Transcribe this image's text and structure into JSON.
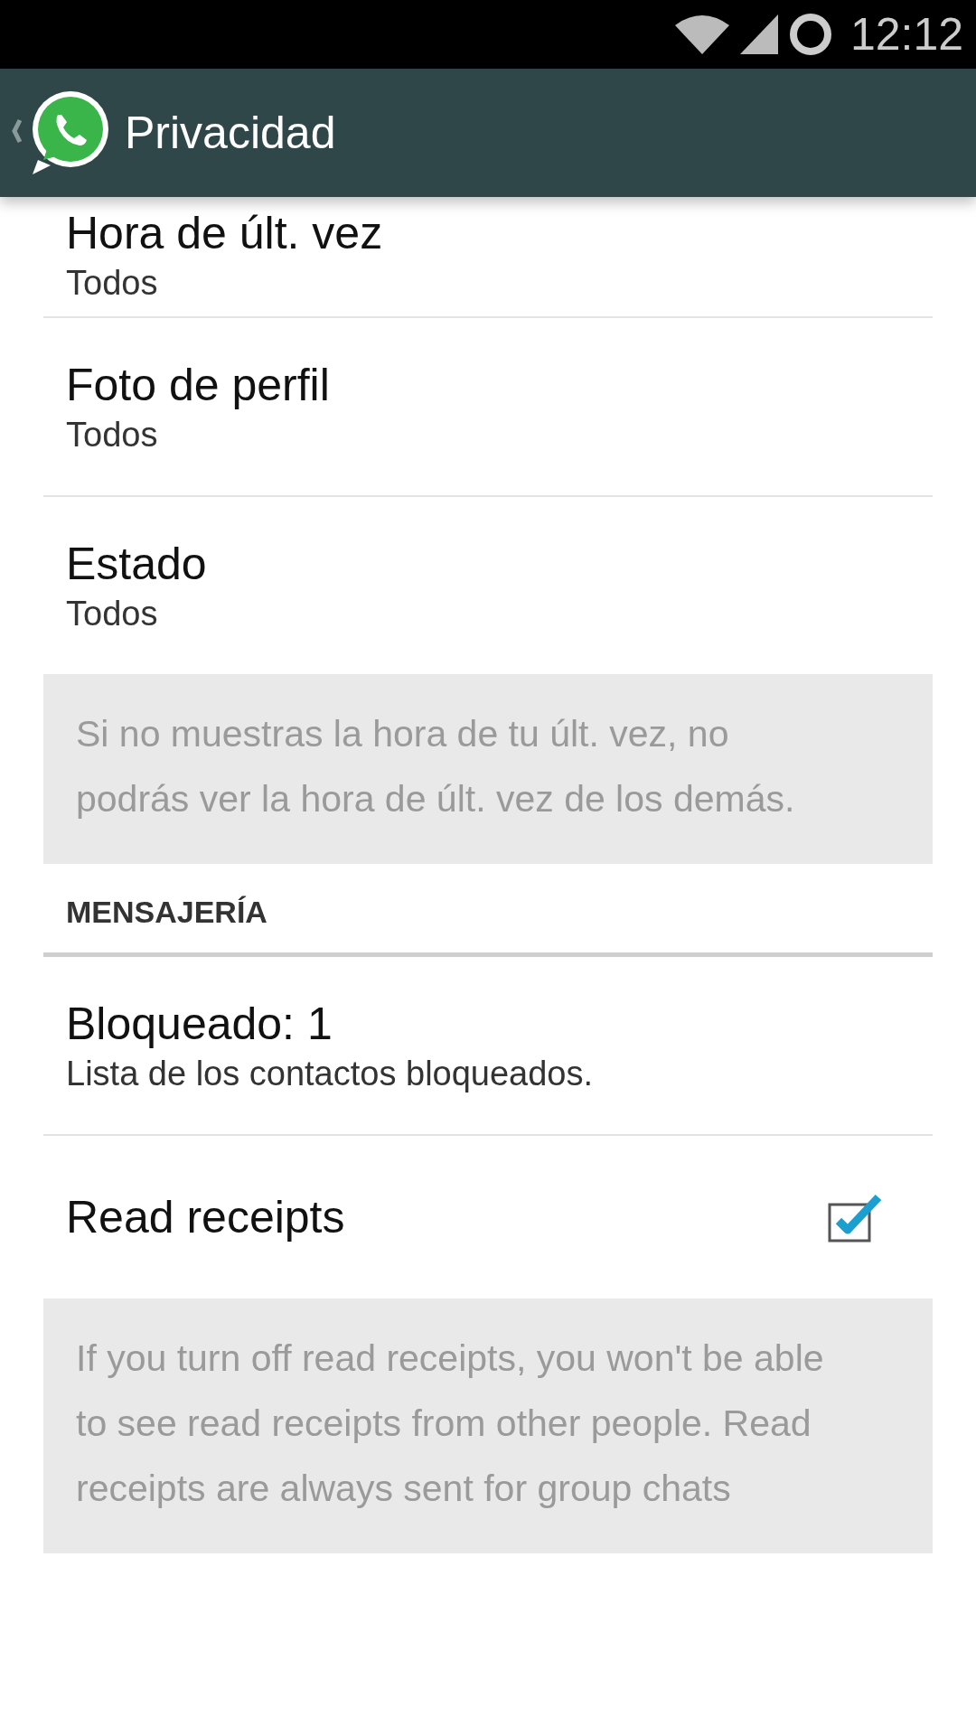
{
  "status_bar": {
    "time": "12:12"
  },
  "action_bar": {
    "title": "Privacidad"
  },
  "sections": [
    {
      "kind": "list",
      "items": [
        {
          "kind": "option",
          "title": "Hora de últ. vez",
          "subtitle": "Todos"
        },
        {
          "kind": "option",
          "title": "Foto de perfil",
          "subtitle": "Todos"
        },
        {
          "kind": "option",
          "title": "Estado",
          "subtitle": "Todos"
        }
      ],
      "note": "Si no muestras la hora de tu últ. vez, no podrás ver la hora de últ. vez de los demás."
    },
    {
      "kind": "list",
      "header": "MENSAJERÍA",
      "items": [
        {
          "kind": "option",
          "title": "Bloqueado: 1",
          "subtitle": "Lista de los contactos bloqueados."
        },
        {
          "kind": "checkbox",
          "title": "Read receipts",
          "checked": true
        }
      ],
      "note": "If you turn off read receipts, you won't be able to see read receipts from other people. Read receipts are always sent for group chats"
    }
  ]
}
